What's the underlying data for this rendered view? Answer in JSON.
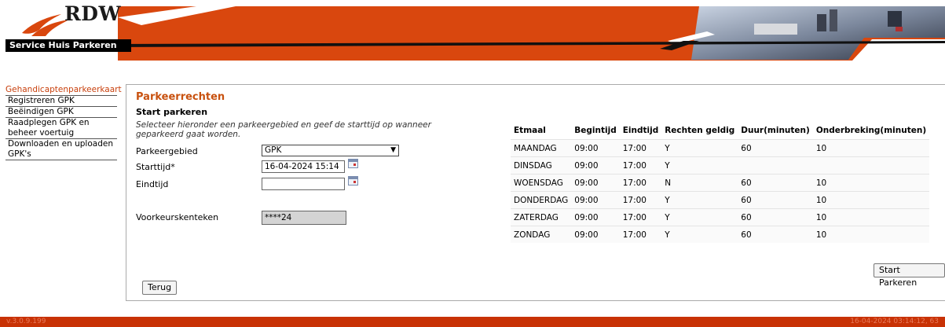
{
  "header": {
    "logo_text": "RDW",
    "service_title": "Service Huis Parkeren",
    "accent_color": "#c83205"
  },
  "menu": {
    "header": "Gehandicaptenparkeerkaart",
    "items": [
      {
        "label": "Registreren GPK"
      },
      {
        "label": "Beëindigen GPK"
      },
      {
        "label": "Raadplegen GPK en beheer voertuig"
      },
      {
        "label": "Downloaden en uploaden GPK's"
      }
    ]
  },
  "main": {
    "title": "Parkeerrechten",
    "subtitle": "Start parkeren",
    "instruction": "Selecteer hieronder een parkeergebied en geef de starttijd op wanneer geparkeerd gaat worden.",
    "fields": {
      "parkeergebied_label": "Parkeergebied",
      "parkeergebied_value": "GPK",
      "starttijd_label": "Starttijd*",
      "starttijd_value": "16-04-2024 15:14",
      "eindtijd_label": "Eindtijd",
      "eindtijd_value": "",
      "kenteken_label": "Voorkeurskenteken",
      "kenteken_value": "****24"
    },
    "table": {
      "headers": [
        "Etmaal",
        "Begintijd",
        "Eindtijd",
        "Rechten geldig",
        "Duur(minuten)",
        "Onderbreking(minuten)"
      ],
      "rows": [
        [
          "MAANDAG",
          "09:00",
          "17:00",
          "Y",
          "60",
          "10"
        ],
        [
          "DINSDAG",
          "09:00",
          "17:00",
          "Y",
          "",
          ""
        ],
        [
          "WOENSDAG",
          "09:00",
          "17:00",
          "N",
          "60",
          "10"
        ],
        [
          "DONDERDAG",
          "09:00",
          "17:00",
          "Y",
          "60",
          "10"
        ],
        [
          "ZATERDAG",
          "09:00",
          "17:00",
          "Y",
          "60",
          "10"
        ],
        [
          "ZONDAG",
          "09:00",
          "17:00",
          "Y",
          "60",
          "10"
        ]
      ]
    },
    "start_button": "Start Parkeren",
    "back_button": "Terug"
  },
  "footer": {
    "version": "v.3.0.9.199",
    "timestamp": "16-04-2024 03:14:12, 63"
  }
}
